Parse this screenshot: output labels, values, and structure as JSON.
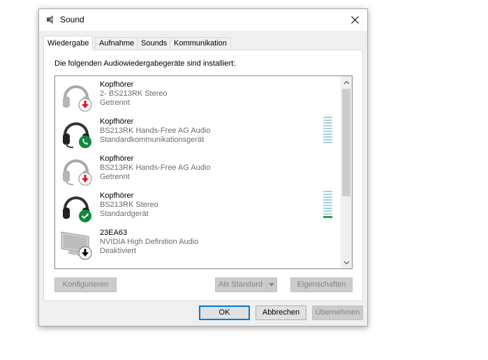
{
  "window": {
    "title": "Sound"
  },
  "tabs": [
    {
      "label": "Wiedergabe",
      "active": true
    },
    {
      "label": "Aufnahme",
      "active": false
    },
    {
      "label": "Sounds",
      "active": false
    },
    {
      "label": "Kommunikation",
      "active": false
    }
  ],
  "panel": {
    "heading": "Die folgenden Audiowiedergabegeräte sind installiert:"
  },
  "devices": [
    {
      "name": "Kopfhörer",
      "desc": "2- BS213RK Stereo",
      "status": "Getrennt",
      "icon": "headphones-disconnected-icon",
      "badge": "red-down-arrow"
    },
    {
      "name": "Kopfhörer",
      "desc": "BS213RK Hands-Free AG Audio",
      "status": "Standardkommunikationsgerät",
      "icon": "headset-icon",
      "badge": "green-phone"
    },
    {
      "name": "Kopfhörer",
      "desc": "BS213RK Hands-Free AG Audio",
      "status": "Getrennt",
      "icon": "headset-disconnected-icon",
      "badge": "red-down-arrow"
    },
    {
      "name": "Kopfhörer",
      "desc": "BS213RK Stereo",
      "status": "Standardgerät",
      "icon": "headphones-icon",
      "badge": "green-check"
    },
    {
      "name": "23EA63",
      "desc": "NVIDIA High Definition Audio",
      "status": "Deaktiviert",
      "icon": "monitor-icon",
      "badge": "black-down-arrow"
    }
  ],
  "buttons": {
    "configure": "Konfigurieren",
    "set_default": "Als Standard",
    "properties": "Eigenschaften",
    "ok": "OK",
    "cancel": "Abbrechen",
    "apply": "Übernehmen"
  },
  "colors": {
    "accent": "#0078d7",
    "meter_idle": "#a7d3e0",
    "meter_active": "#2ea043",
    "status_red": "#e81123",
    "status_green": "#10893e"
  }
}
